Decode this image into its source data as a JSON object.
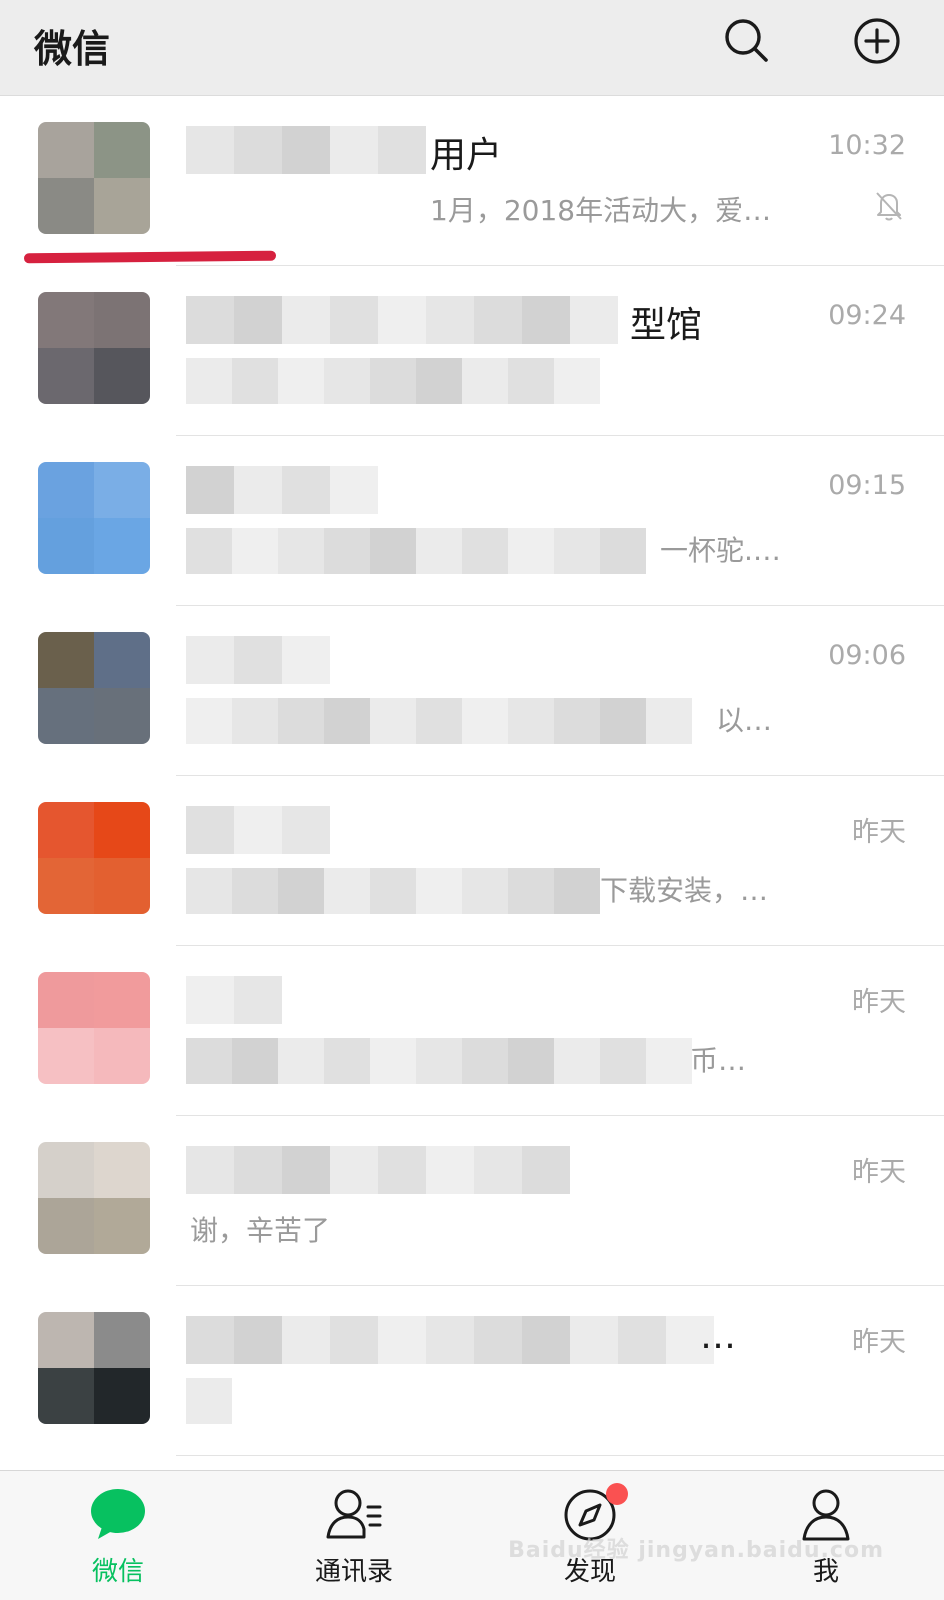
{
  "header": {
    "title": "微信"
  },
  "chats": [
    {
      "name": "用户",
      "preview": "1月，2018年活动大，爱…",
      "time": "10:32",
      "muted": true,
      "avatar_colors": [
        "#a8a39c",
        "#8c9486",
        "#8a8a85",
        "#a8a498"
      ]
    },
    {
      "name": "型馆",
      "preview": "",
      "time": "09:24",
      "muted": false,
      "avatar_colors": [
        "#827879",
        "#7c7374",
        "#6b686e",
        "#56565c"
      ]
    },
    {
      "name": "",
      "preview": "一杯驼.…",
      "time": "09:15",
      "muted": false,
      "avatar_colors": [
        "#6aa2e0",
        "#7aaee6",
        "#64a0de",
        "#6aa6e4"
      ]
    },
    {
      "name": "",
      "preview": "以…",
      "time": "09:06",
      "muted": false,
      "avatar_colors": [
        "#6a604c",
        "#5f6f88",
        "#66707d",
        "#68707a"
      ]
    },
    {
      "name": "",
      "preview": "下载安装，…",
      "time": "昨天",
      "muted": false,
      "avatar_colors": [
        "#e5562f",
        "#e64818",
        "#e36536",
        "#e36030"
      ]
    },
    {
      "name": "",
      "preview": "币…",
      "time": "昨天",
      "muted": false,
      "avatar_colors": [
        "#ef9a9c",
        "#f19b9c",
        "#f6c0c3",
        "#f5b9bc"
      ]
    },
    {
      "name": "",
      "preview": "谢，辛苦了",
      "time": "昨天",
      "muted": false,
      "avatar_colors": [
        "#d5d0ca",
        "#ddd6ce",
        "#aca598",
        "#b1a998"
      ]
    },
    {
      "name": "…",
      "preview": "",
      "time": "昨天",
      "muted": false,
      "avatar_colors": [
        "#bdb6b0",
        "#8b8b8b",
        "#3b4143",
        "#22272a"
      ]
    }
  ],
  "tabs": [
    {
      "label": "微信",
      "icon": "chat-bubble-icon",
      "active": true
    },
    {
      "label": "通讯录",
      "icon": "contacts-icon",
      "active": false
    },
    {
      "label": "发现",
      "icon": "compass-icon",
      "active": false,
      "badge_dot": true
    },
    {
      "label": "我",
      "icon": "person-icon",
      "active": false
    }
  ],
  "watermark": "Baidu经验 jingyan.baidu.com",
  "colors": {
    "accent": "#07c160",
    "header_bg": "#ededed",
    "badge": "#fa5151",
    "annotation_underline": "#d6213f"
  }
}
